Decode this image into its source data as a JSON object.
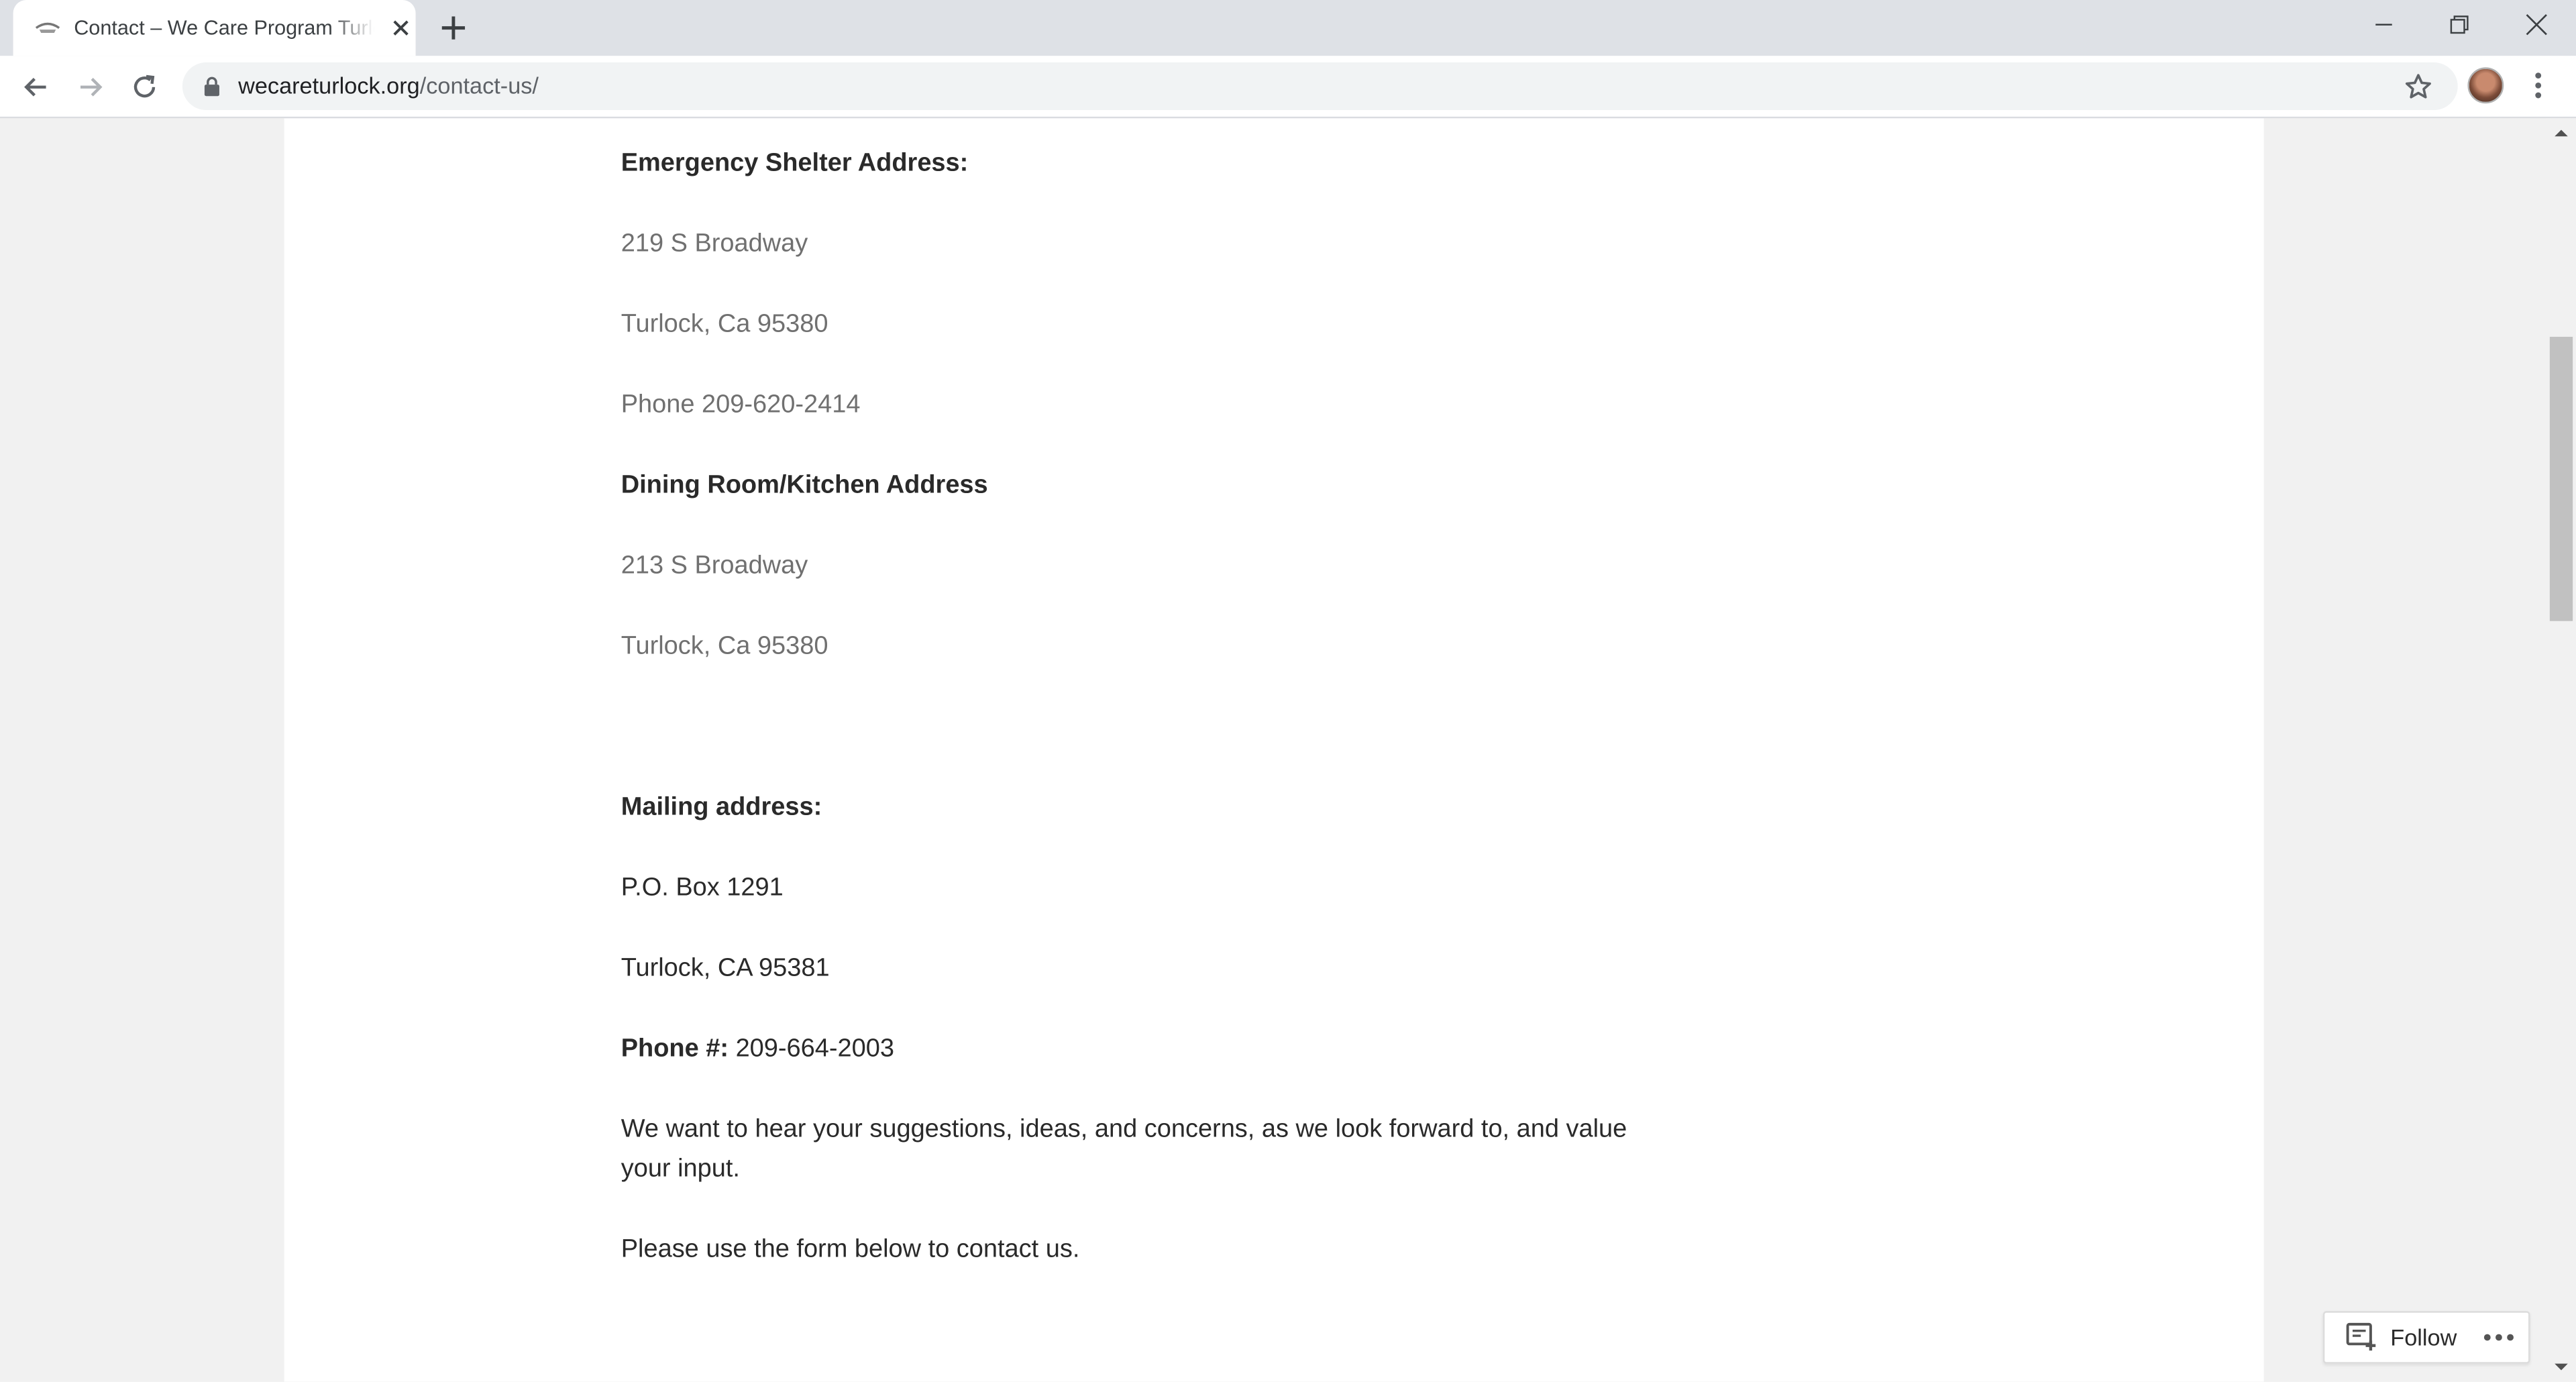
{
  "browser": {
    "tab_title": "Contact – We Care Program Turlock",
    "url_domain": "wecareturlock.org",
    "url_path": "/contact-us/"
  },
  "content": {
    "shelter_heading": "Emergency Shelter Address:",
    "shelter_street": "219 S Broadway",
    "shelter_city": "Turlock, Ca 95380",
    "shelter_phone": "Phone 209-620-2414",
    "dining_heading": "Dining Room/Kitchen Address",
    "dining_street": "213 S Broadway",
    "dining_city": "Turlock, Ca 95380",
    "mailing_heading": "Mailing address:",
    "mailing_box": "P.O. Box 1291",
    "mailing_city": "Turlock, CA 95381",
    "phone_label": "Phone #:",
    "phone_value": " 209-664-2003",
    "suggestions_text": "We want to hear your suggestions, ideas, and concerns, as we look forward to, and value your input.",
    "form_prompt": "Please use the form below to contact us."
  },
  "follow_widget": {
    "label": "Follow"
  },
  "colors": {
    "tabstrip_bg": "#dee1e6",
    "page_bg": "#f1f1f1",
    "card_bg": "#ffffff",
    "text": "#2a2a2a",
    "muted_text": "#707070"
  }
}
